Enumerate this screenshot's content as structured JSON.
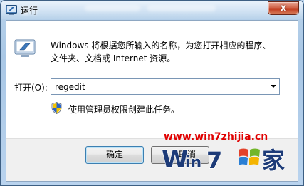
{
  "window": {
    "title": "运行",
    "close_label": "x"
  },
  "dialog": {
    "description_line1": "Windows 将根据您所输入的名称，为您打开相应的程序、",
    "description_line2": "文件夹、文档或 Internet 资源。",
    "open_label": "打开(O):",
    "open_value": "regedit",
    "admin_note": "使用管理员权限创建此任务。"
  },
  "buttons": {
    "ok_label": "确定",
    "cancel_label": "取消"
  },
  "watermark": {
    "url": "www.win7zhijia.cn",
    "logo_text": "Win7",
    "logo_char": "家"
  },
  "icons": {
    "app": "run-icon",
    "shield": "uac-shield-icon"
  },
  "colors": {
    "watermark": "#e00000",
    "close_button": "#c13a1e"
  }
}
